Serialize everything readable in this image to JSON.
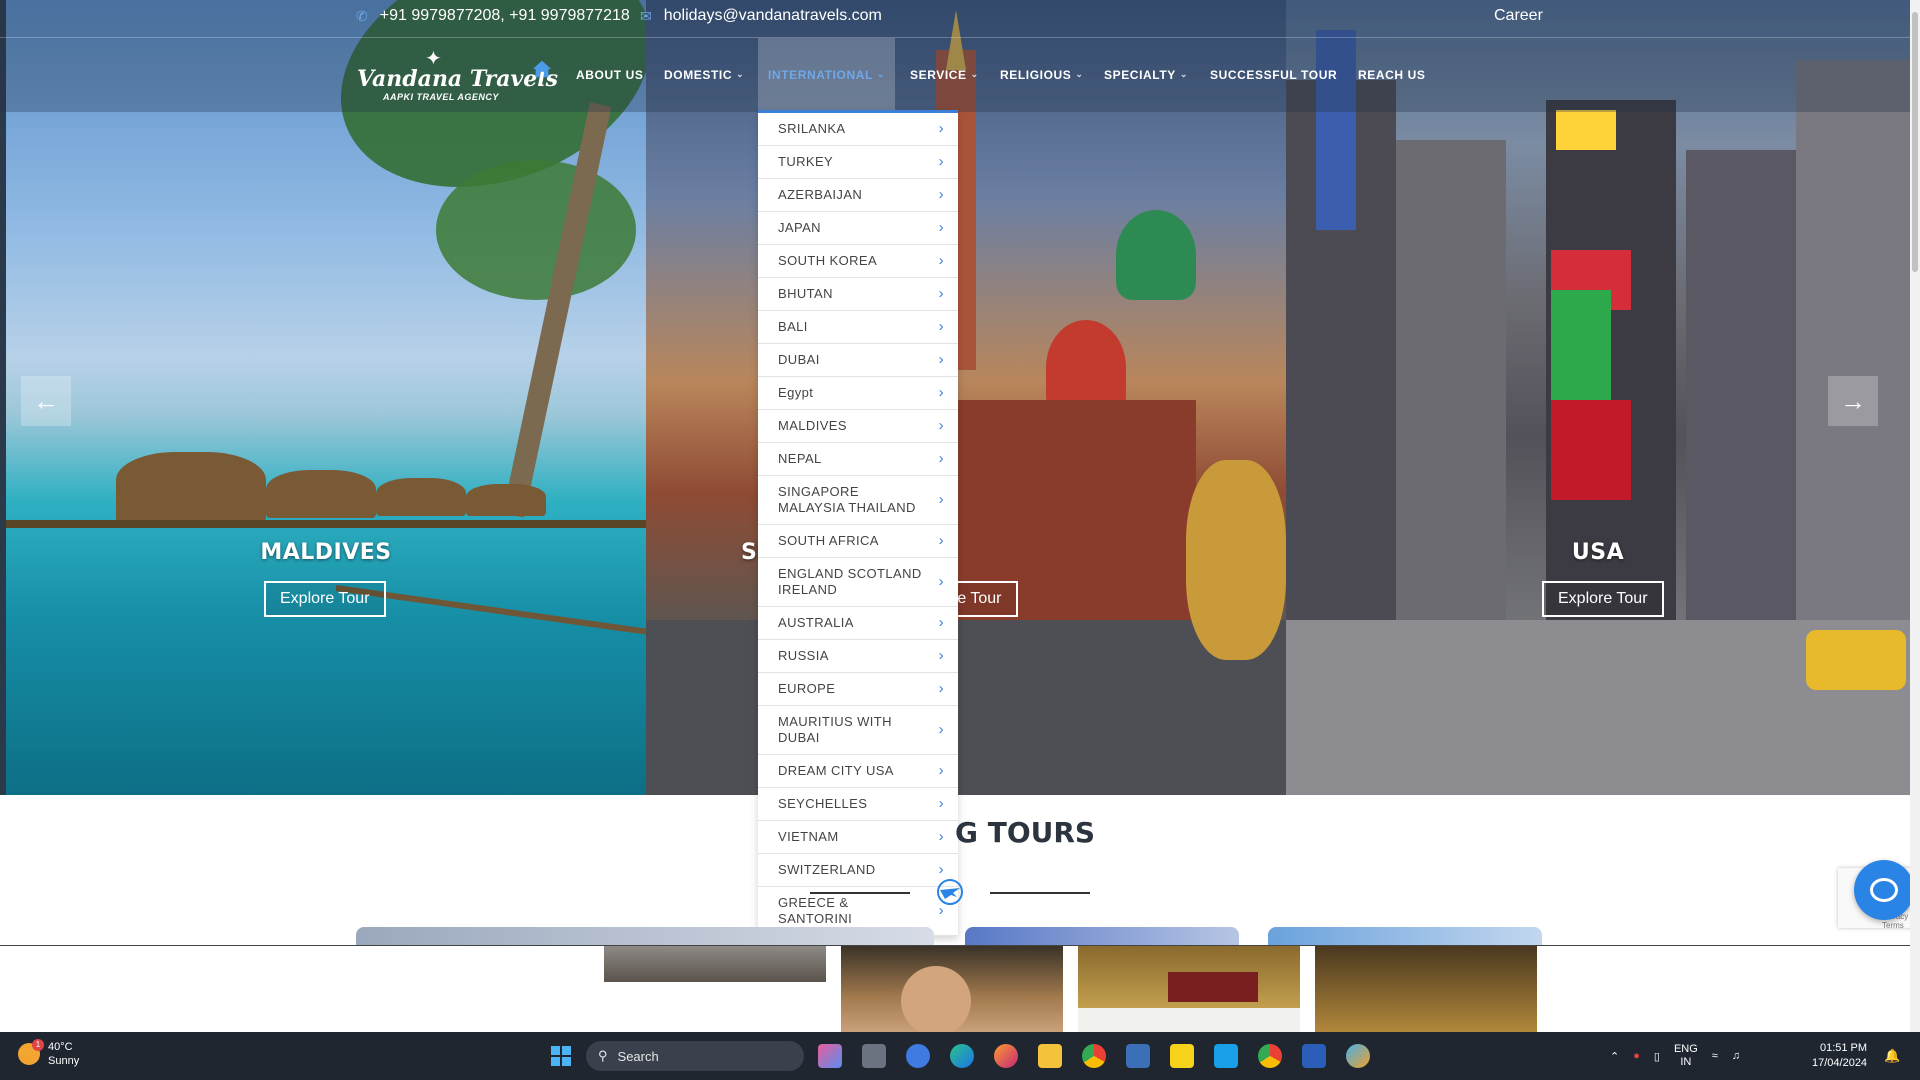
{
  "topbar": {
    "phone": "+91 9979877208, +91 9979877218",
    "email": "holidays@vandanatravels.com",
    "career": "Career",
    "phone_icon": "phone-icon",
    "email_icon": "envelope-icon"
  },
  "logo": {
    "name": "Vandana Travels",
    "tagline": "AAPKI TRAVEL AGENCY"
  },
  "nav": {
    "home_icon": "home-icon",
    "items": [
      {
        "label": "ABOUT US",
        "has_dropdown": false
      },
      {
        "label": "DOMESTIC",
        "has_dropdown": true
      },
      {
        "label": "INTERNATIONAL",
        "has_dropdown": true,
        "active": true
      },
      {
        "label": "SERVICE",
        "has_dropdown": true
      },
      {
        "label": "RELIGIOUS",
        "has_dropdown": true
      },
      {
        "label": "SPECIALTY",
        "has_dropdown": true
      },
      {
        "label": "SUCCESSFUL TOUR",
        "has_dropdown": false
      },
      {
        "label": "REACH US",
        "has_dropdown": false
      }
    ]
  },
  "dropdown": {
    "items": [
      "SRILANKA",
      "TURKEY",
      "AZERBAIJAN",
      "JAPAN",
      "SOUTH KOREA",
      "BHUTAN",
      "BALI",
      "DUBAI",
      "Egypt",
      "MALDIVES",
      "NEPAL",
      "SINGAPORE MALAYSIA THAILAND",
      "SOUTH AFRICA",
      "ENGLAND SCOTLAND IRELAND",
      "AUSTRALIA",
      "RUSSIA",
      "EUROPE",
      "MAURITIUS WITH DUBAI",
      "DREAM CITY USA",
      "SEYCHELLES",
      "VIETNAM",
      "SWITZERLAND",
      "GREECE & SANTORINI"
    ]
  },
  "slides": [
    {
      "title": "MALDIVES",
      "button": "Explore Tour"
    },
    {
      "title": "SSIA",
      "button": "re Tour"
    },
    {
      "title": "USA",
      "button": "Explore Tour"
    }
  ],
  "section": {
    "title": "G TOURS"
  },
  "recaptcha": {
    "text": "Privacy - Terms"
  },
  "taskbar": {
    "weather_temp": "40°C",
    "weather_desc": "Sunny",
    "weather_badge": "1",
    "search_placeholder": "Search",
    "lang_top": "ENG",
    "lang_bottom": "IN",
    "time": "01:51 PM",
    "date": "17/04/2024"
  },
  "colors": {
    "accent": "#3c7fd8",
    "nav_active": "#6fa8e8",
    "chat": "#2a84e6",
    "taskbar": "#1f2630"
  }
}
